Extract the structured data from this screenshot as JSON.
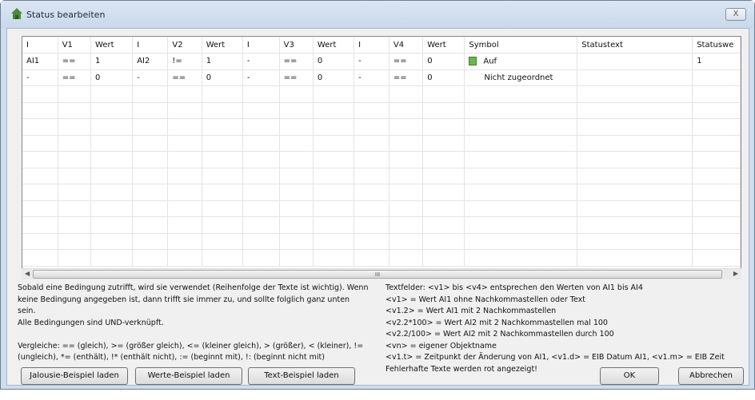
{
  "window": {
    "title": "Status bearbeiten",
    "close_label": "X"
  },
  "table": {
    "headers": [
      "I",
      "V1",
      "Wert",
      "I",
      "V2",
      "Wert",
      "I",
      "V3",
      "Wert",
      "I",
      "V4",
      "Wert",
      "Symbol",
      "Statustext",
      "Statuswe"
    ],
    "rows": [
      [
        "AI1",
        "==",
        "1",
        "AI2",
        "!=",
        "1",
        "-",
        "==",
        "0",
        "-",
        "==",
        "0",
        "Auf",
        "",
        "1"
      ],
      [
        "-",
        "==",
        "0",
        "-",
        "==",
        "0",
        "-",
        "==",
        "0",
        "-",
        "==",
        "0",
        "Nicht zugeordnet",
        "",
        ""
      ]
    ],
    "symbol_color": "#6bb54a"
  },
  "scrollbar": {
    "thumb_label": "III"
  },
  "help_left": [
    "Sobald eine Bedingung zutrifft, wird sie verwendet (Reihenfolge der Texte ist wichtig). Wenn",
    "keine Bedingung angegeben ist, dann trifft sie immer zu, und sollte folglich ganz unten sein.",
    "Alle Bedingungen sind UND-verknüpft.",
    "",
    "Vergleiche: == (gleich), >= (größer gleich), <= (kleiner gleich), > (größer), < (kleiner), !=",
    "(ungleich), *= (enthält), !* (enthält nicht), := (beginnt mit), !: (beginnt nicht mit)"
  ],
  "help_right": [
    "Textfelder: <v1> bis <v4> entsprechen den Werten von AI1 bis AI4",
    "<v1> = Wert AI1 ohne Nachkommastellen oder Text",
    "<v1.2> = Wert AI1 mit 2 Nachkommastellen",
    "<v2.2*100> = Wert AI2 mit 2 Nachkommastellen mal 100",
    "<v2.2/100> = Wert AI2 mit 2 Nachkommastellen durch 100",
    "<vn> = eigener Objektname",
    "<v1.t> = Zeitpunkt der Änderung von AI1, <v1.d> = EIB Datum AI1, <v1.m> = EIB Zeit",
    "Fehlerhafte Texte werden rot angezeigt!"
  ],
  "buttons": {
    "jalousie": "Jalousie-Beispiel laden",
    "werte": "Werte-Beispiel laden",
    "text": "Text-Beispiel laden",
    "ok": "OK",
    "cancel": "Abbrechen"
  }
}
